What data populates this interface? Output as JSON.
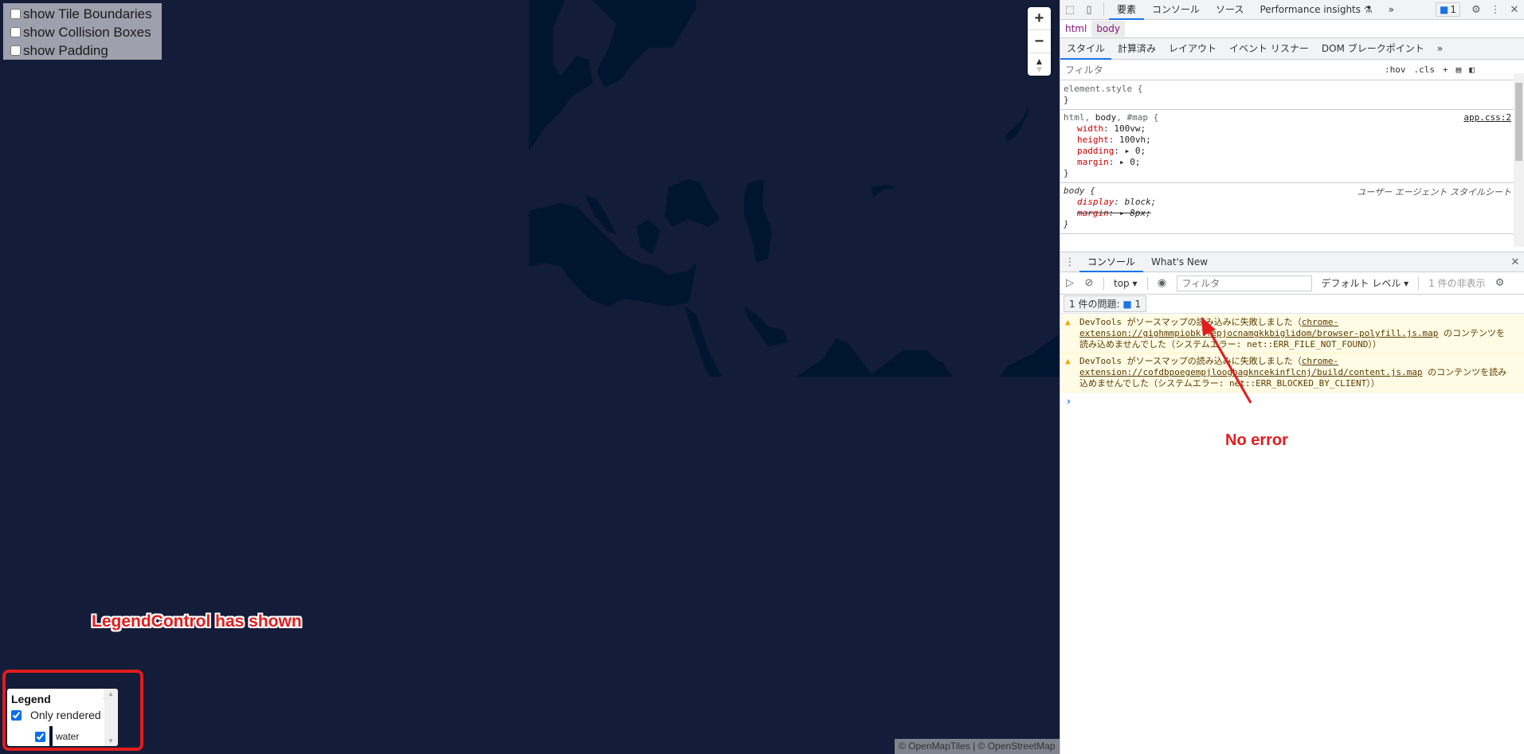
{
  "map": {
    "debug_options": [
      {
        "label": "show Tile Boundaries",
        "checked": false
      },
      {
        "label": "show Collision Boxes",
        "checked": false
      },
      {
        "label": "show Padding",
        "checked": false
      }
    ],
    "zoom_in": "+",
    "zoom_out": "−",
    "compass": "▲",
    "compass_down": "▼",
    "attribution": "© OpenMapTiles | © OpenStreetMap",
    "colors": {
      "land": "#131c38",
      "water": "#001530"
    }
  },
  "legend": {
    "title": "Legend",
    "close": "x",
    "only_rendered_label": "Only rendered",
    "only_rendered_checked": true,
    "layers": [
      {
        "label": "water",
        "checked": true,
        "color": "#001530"
      }
    ]
  },
  "annotations": {
    "legend_note": "LegendControl has shown",
    "console_note": "No error"
  },
  "devtools": {
    "top_tabs": [
      {
        "label": "要素",
        "active": true
      },
      {
        "label": "コンソール",
        "active": false
      },
      {
        "label": "ソース",
        "active": false
      },
      {
        "label": "Performance insights ⚗",
        "active": false
      }
    ],
    "more_tabs": "»",
    "issues_count": "1",
    "breadcrumbs": [
      "html",
      "body"
    ],
    "sub_tabs": [
      {
        "label": "スタイル",
        "active": true
      },
      {
        "label": "計算済み",
        "active": false
      },
      {
        "label": "レイアウト",
        "active": false
      },
      {
        "label": "イベント リスナー",
        "active": false
      },
      {
        "label": "DOM ブレークポイント",
        "active": false
      }
    ],
    "filter_placeholder": "フィルタ",
    "hov": ":hov",
    "cls": ".cls",
    "rules": {
      "element_style": "element.style {",
      "rule2_selector_a": "html, ",
      "rule2_selector_b": "body",
      "rule2_selector_c": ", #map {",
      "rule2_source": "app.css:2",
      "rule2_decls": [
        {
          "prop": "width",
          "value": "100vw;"
        },
        {
          "prop": "height",
          "value": "100vh;"
        },
        {
          "prop": "padding",
          "value": "▸ 0;"
        },
        {
          "prop": "margin",
          "value": "▸ 0;"
        }
      ],
      "rule3_selector": "body {",
      "rule3_source": "ユーザー エージェント スタイルシート",
      "rule3_decls": [
        {
          "prop": "display",
          "value": "block;"
        },
        {
          "prop": "margin",
          "value": "▸ 8px;"
        }
      ],
      "close": "}"
    },
    "drawer": {
      "tabs": [
        {
          "label": "コンソール",
          "active": true
        },
        {
          "label": "What's New",
          "active": false
        }
      ],
      "context": "top ▾",
      "filter_placeholder": "フィルタ",
      "level": "デフォルト レベル ▾",
      "hidden": "1 件の非表示",
      "issues_label": "1 件の問題:",
      "issues_count": "1",
      "messages": [
        {
          "prefix": "DevTools がソースマップの読み込みに失敗しました（",
          "link": "chrome-extension://gighmmpiobklfepjocnamgkkbiglidom/browser-polyfill.js.map",
          "suffix": " のコンテンツを読み込めませんでした（システムエラー: net::ERR_FILE_NOT_FOUND））"
        },
        {
          "prefix": "DevTools がソースマップの読み込みに失敗しました（",
          "link": "chrome-extension://cofdbpoegempjloogbagkncekinflcnj/build/content.js.map",
          "suffix": " のコンテンツを読み込めませんでした（システムエラー: net::ERR_BLOCKED_BY_CLIENT））"
        }
      ],
      "prompt": "›"
    }
  }
}
